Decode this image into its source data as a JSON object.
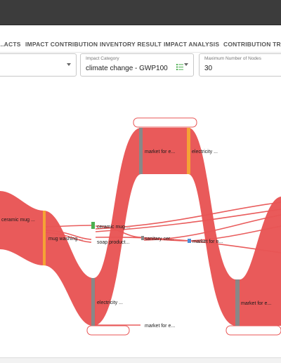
{
  "tabs": [
    "...ACTS",
    "IMPACT CONTRIBUTION",
    "INVENTORY RESULT",
    "IMPACT ANALYSIS",
    "CONTRIBUTION TREE"
  ],
  "impact_category": {
    "label": "Impact Category",
    "value": "climate change - GWP100"
  },
  "max_nodes": {
    "label": "Maximum Number of Nodes",
    "value": "30"
  },
  "sankey": {
    "nodes": [
      "ceramic mug ...",
      "mug washing ...",
      "ceramic mug ...",
      "soap product...",
      "market for e...",
      "electricity ...",
      "electricity ...",
      "market for e...",
      "sanitary cer...",
      "market for n...",
      "market for e..."
    ]
  },
  "colors": {
    "flow": "#e85555",
    "node": "#888888",
    "accent_orange": "#f5a235",
    "accent_green": "#4caf50",
    "accent_blue": "#4a90d9"
  }
}
